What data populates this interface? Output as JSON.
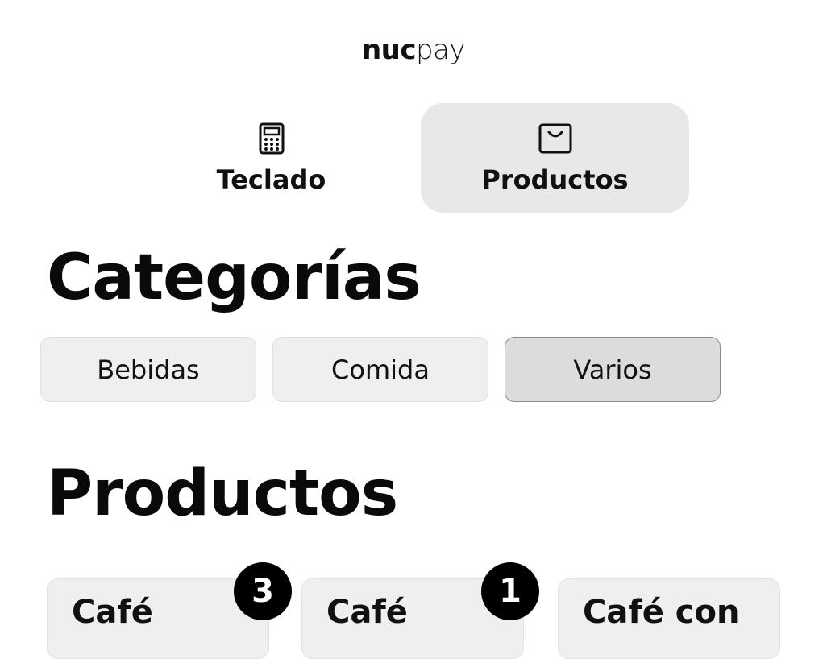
{
  "brand": {
    "logo_bold": "nuc",
    "logo_light": "pay"
  },
  "mode_tabs": [
    {
      "label": "Teclado",
      "icon": "calculator-icon",
      "selected": false
    },
    {
      "label": "Productos",
      "icon": "shopping-bag-icon",
      "selected": true
    }
  ],
  "categories": {
    "title": "Categorías",
    "items": [
      {
        "label": "Bebidas",
        "selected": false
      },
      {
        "label": "Comida",
        "selected": false
      },
      {
        "label": "Varios",
        "selected": true
      }
    ]
  },
  "products": {
    "title": "Productos",
    "items": [
      {
        "name": "Café",
        "count": "3"
      },
      {
        "name": "Café",
        "count": "1"
      },
      {
        "name": "Café con",
        "count": ""
      }
    ]
  },
  "colors": {
    "selected_tab_bg": "#e8e8e8",
    "button_bg": "#efefef",
    "selected_button_bg": "#dcdcdc",
    "badge_bg": "#000000"
  }
}
